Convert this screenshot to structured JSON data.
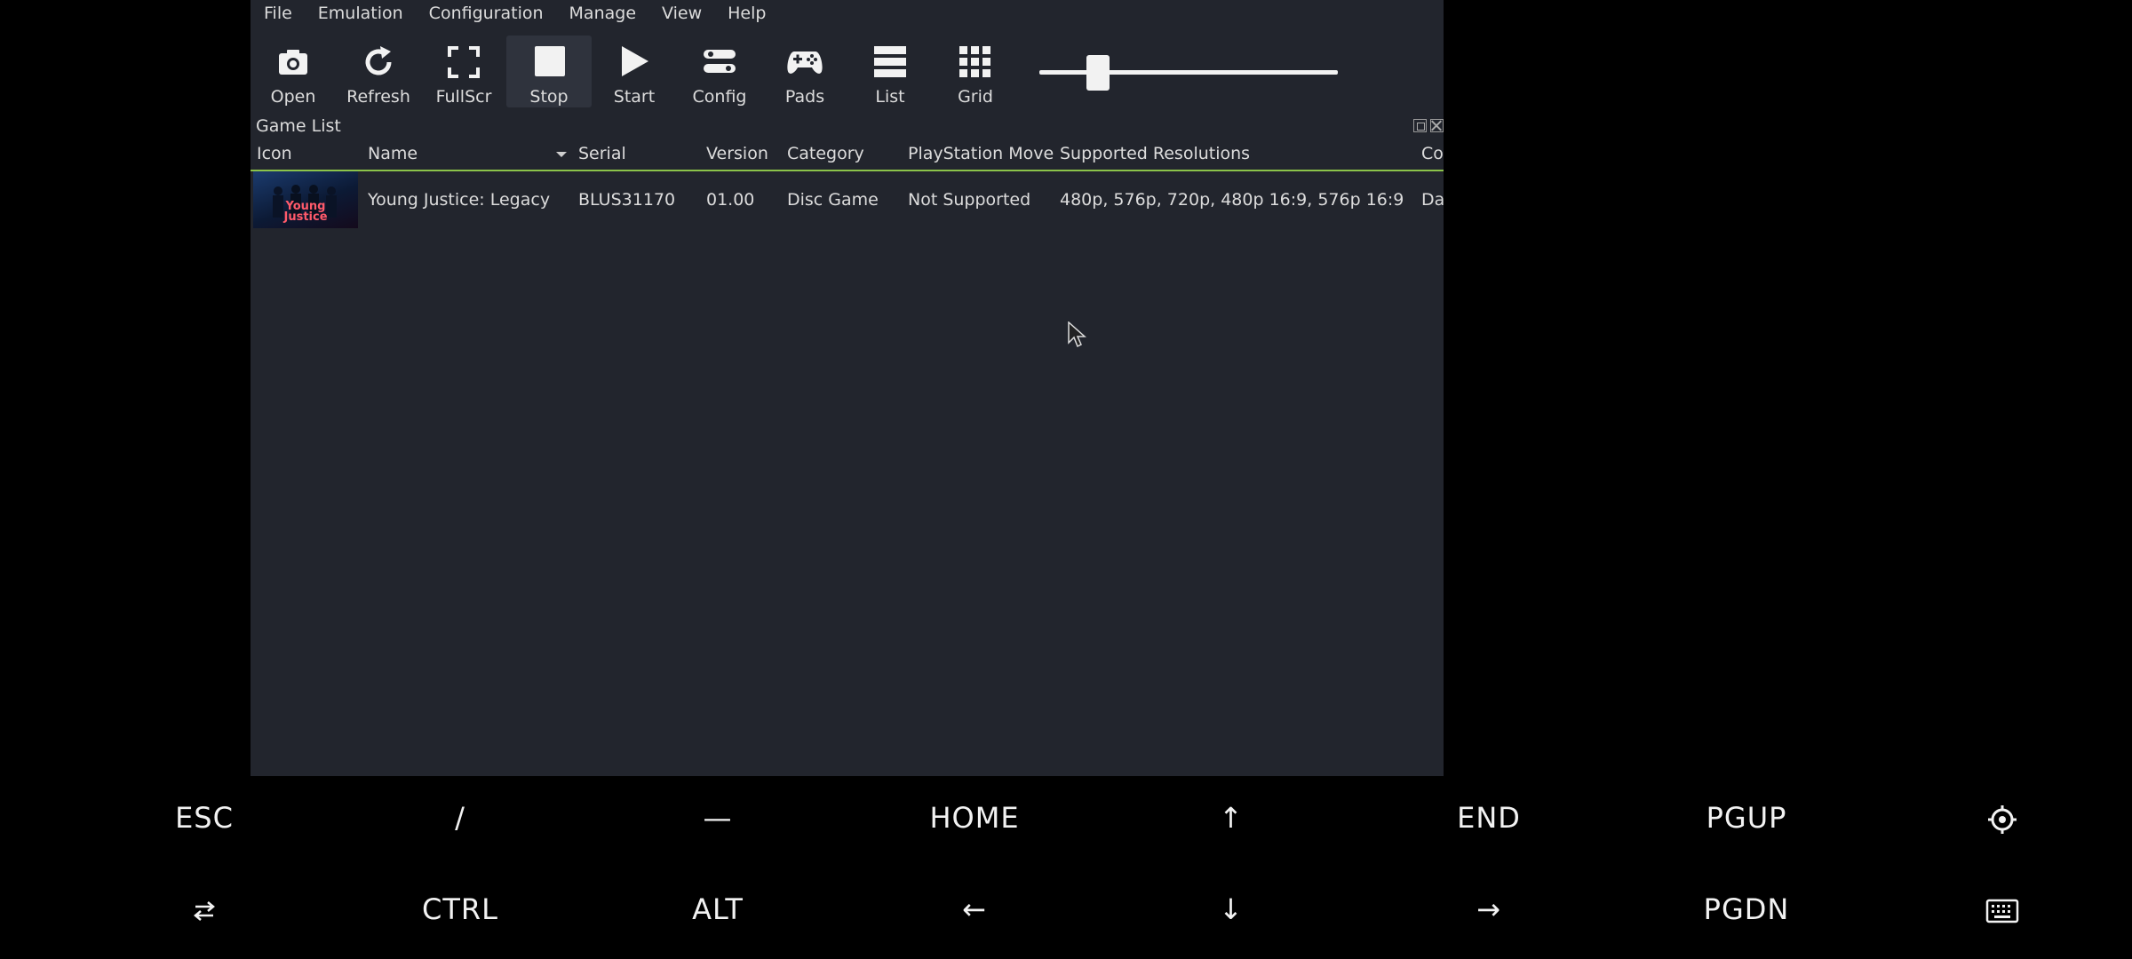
{
  "menu": [
    "File",
    "Emulation",
    "Configuration",
    "Manage",
    "View",
    "Help"
  ],
  "toolbar": {
    "open": "Open",
    "refresh": "Refresh",
    "fullscr": "FullScr",
    "stop": "Stop",
    "start": "Start",
    "config": "Config",
    "pads": "Pads",
    "list": "List",
    "grid": "Grid",
    "zoom_slider_level": 0.17
  },
  "game_list": {
    "title": "Game List",
    "columns": [
      "Icon",
      "Name",
      "Serial",
      "Version",
      "Category",
      "PlayStation Move",
      "Supported Resolutions",
      "Co"
    ],
    "rows": [
      {
        "icon_logo": "Young Justice",
        "name": "Young Justice: Legacy",
        "serial": "BLUS31170",
        "version": "01.00",
        "category": "Disc Game",
        "move": "Not Supported",
        "resolutions": "480p, 576p, 720p, 480p 16:9, 576p 16:9",
        "extra": "Da"
      }
    ]
  },
  "keys": {
    "row1": [
      "ESC",
      "/",
      "—",
      "HOME",
      "↑",
      "END",
      "PGUP",
      "settings-icon"
    ],
    "row2": [
      "tab-icon",
      "CTRL",
      "ALT",
      "←",
      "↓",
      "→",
      "PGDN",
      "keyboard-icon"
    ]
  }
}
